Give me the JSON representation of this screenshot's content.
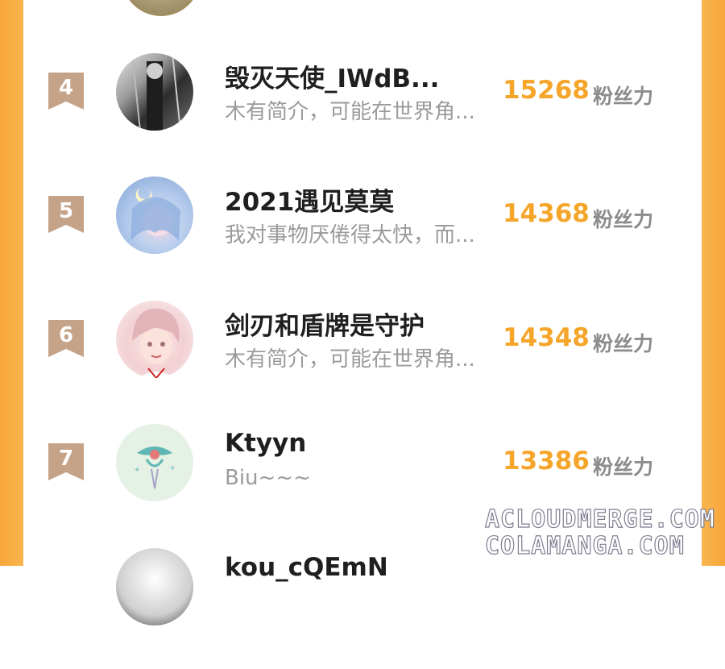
{
  "leaderboard": {
    "unit_label": "粉丝力",
    "entries": [
      {
        "rank": "4",
        "name": "毁灭天使_IWdB...",
        "bio": "木有简介，可能在世界角...",
        "score": "15268",
        "avatar_icon": "dark-figure-avatar"
      },
      {
        "rank": "5",
        "name": "2021遇见莫莫",
        "bio": "我对事物厌倦得太快，而...",
        "score": "14368",
        "avatar_icon": "blue-hair-girl-avatar"
      },
      {
        "rank": "6",
        "name": "剑刃和盾牌是守护",
        "bio": "木有简介，可能在世界角...",
        "score": "14348",
        "avatar_icon": "pink-hair-boy-avatar"
      },
      {
        "rank": "7",
        "name": "Ktyyn",
        "bio": "Biu~~~",
        "score": "13386",
        "avatar_icon": "emblem-avatar"
      },
      {
        "rank": "",
        "name": "kou_cQEmN",
        "bio": "",
        "score": "",
        "avatar_icon": "partial-avatar"
      }
    ]
  },
  "watermarks": [
    "ACLOUDMERGE.COM",
    "COLAMANGA.COM"
  ],
  "colors": {
    "accent": "#f5a52a",
    "frame": "#f7a63a",
    "rank_badge": "#c4a389"
  }
}
